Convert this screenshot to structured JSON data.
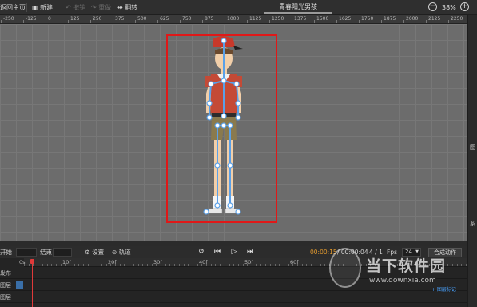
{
  "toolbar": {
    "back_home": "返回主页",
    "new": "新建",
    "undo": "撤销",
    "redo": "重做",
    "flip": "翻转",
    "title": "青春阳光男孩",
    "zoom": "38%"
  },
  "ruler": {
    "labels": [
      "-250",
      "-125",
      "0",
      "125",
      "250",
      "375",
      "500",
      "625",
      "750",
      "875",
      "1000",
      "1125",
      "1250",
      "1375",
      "1500",
      "1625",
      "1750",
      "1875",
      "2000",
      "2125",
      "2250"
    ]
  },
  "playbar": {
    "start_label": "开始",
    "end_label": "结束",
    "settings": "设置",
    "track": "轨道",
    "time_current": "00:00:15",
    "time_total": "/ 00:00:04",
    "frame": "4 / 1",
    "fps_label": "Fps",
    "fps_value": "24",
    "compose_button": "合成动作"
  },
  "timeline": {
    "labels": [
      "0s",
      "10f",
      "20f",
      "30f",
      "40f",
      "50f",
      "60f"
    ],
    "rows": [
      "发布",
      "图层",
      "图层"
    ],
    "end_label": "+ 图层标记"
  },
  "right_panel": {
    "labels": [
      "图",
      "系"
    ]
  },
  "watermark": {
    "text": "当下软件园",
    "url": "www.downxia.com"
  },
  "colors": {
    "stage_border": "#e01818",
    "accent_time": "#e39a2e",
    "playhead": "#e03a3a",
    "bone": "#5aa0e8"
  }
}
